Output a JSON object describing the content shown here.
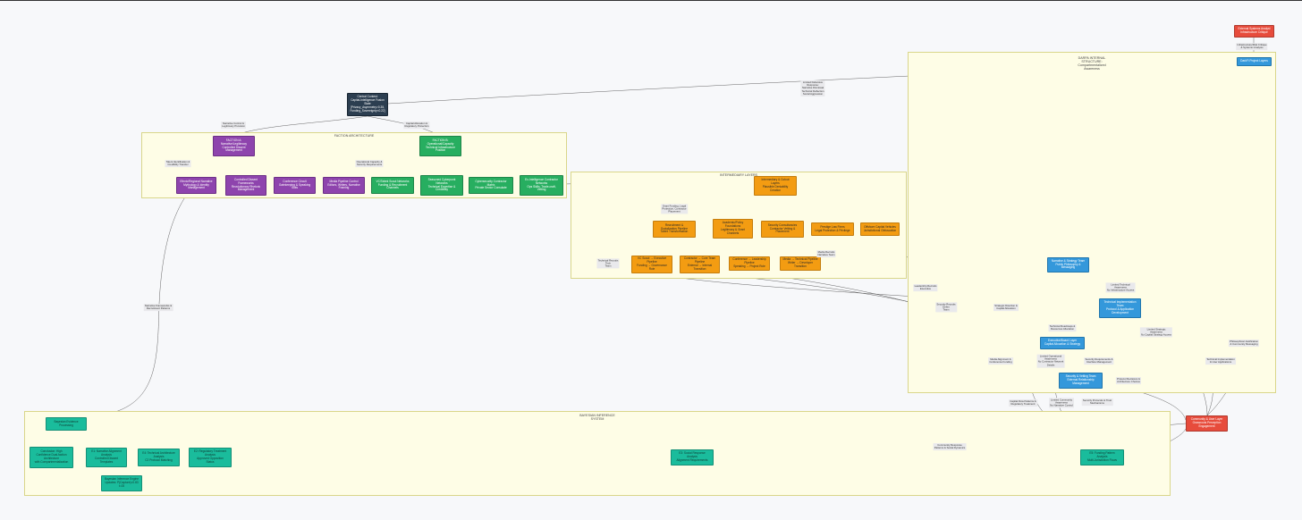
{
  "clusters": {
    "faction": "FACTION ARCHITECTURE",
    "intermediary": "INTERMEDIARY LAYERS",
    "darpa": "DARPA INTERNAL\nSTRUCTURE:\nCompartmentalized\nAwareness",
    "bayesian": "BAYESIAN INFERENCE\nSYSTEM"
  },
  "nodes": {
    "central": "Central Contest:\nCapital-Intelligence Fusion\nState\n[Privacy_Asymmetry>0.35,\nFunding_Sovereignty<0.22]",
    "factionA": "FACTION A:\nNarrative/Legitimacy\nControlled Dissent\nManagement",
    "factionB": "FACTION B:\nOperational/Capacity\nTechnical Infrastructure\nPosition",
    "a1": "Ethnic/Regional Narrative\nMythology & Identity\nManagement",
    "a2": "Controlled Dissent\nFrameworks\nRevolutionary Rhetoric\nManagement",
    "a3": "Conference Circuit\nGatekeeping & Speaking\nSlots",
    "a4": "Media Pipeline Control\nEditors, Writers, Narrative\nFraming",
    "b1": "VC/Talent Scout Networks\nFunding & Recruitment\nChannels",
    "b2": "Seasoned Cyberpunk\nNetworks\nTechnical Expertise &\nCredibility",
    "b3": "Cybersecurity Contractor\nMatrix\nPrivate Sector Consulate",
    "b4": "Ex-Intelligence Contractor\nNetworks\nOps Skills, Trade-craft,\nVetting",
    "intermediaryHub": "Intermediary & Cutout\nLayers\nPlausible Deniability\nCreation",
    "recruitPipeline": "Recruitment &\nSocialization Pipeline\nTalent Transformation",
    "academic": "Academic/Policy\nFoundations\nLegitimacy & Grant\nChannels",
    "securityConsultancies": "Security Consultancies\nContractor Vetting &\nPlacement",
    "lawFirms": "Prestige Law Firms\nLegal Protection & Privilege",
    "offshore": "Offshore Capital Vehicles\nJurisdictional Obfuscation",
    "vcScout": "VC Scout → Executive\nPipeline\nFunding → Governance\nRole",
    "contractorHire": "Contractor → Core Team\nPipeline\nExternal → Internal\nTransition",
    "conferenceLeader": "Conference → Leadership\nPipeline\nSpeaking → Project Role",
    "mediaTech": "Media → Technical Pipeline\nWriter → Developer\nTransition",
    "external": "External Systems Analyst\nInfrastructure Critique",
    "darpaLayer": "DarkFi Project Layers",
    "narrativeTeam": "Narrative & Strategy Team\nPublic Philosophy &\nMessaging",
    "techTeam": "Technical Implementation\nTeam\nProtocol & Application\nDevelopment",
    "execBoard": "Executive/Board Layer\nCapital Allocation & Strategy",
    "securityTeam": "Security & Vetting Team\nExternal Relationship\nManagement",
    "community": "Community & User Layer\nGrassroots Perception\nEngagement",
    "bayesHub": "Bayesian Evidence\nProcessing",
    "conclusion": "Conclusion: High\nConfidence Dual-faction\nArchitecture\nwith Compartmentalization",
    "e1": "E1: Narrative Alignment\nAnalysis\nControlled Dissent\nTemplates",
    "e4": "E4: Technical Architecture\nAnalysis\nC2 Protocol Matching",
    "e2": "E2: Regulatory Treatment\nAnalysis\nApproved Opposition\nStatus",
    "e3": "E3: Social Response\nAnalysis\nAlignment Requirements",
    "e5": "E5: Funding Pattern\nAnalysis\nMulti-Jurisdiction Flows",
    "inferenceEngine": "Bayesian Inference Engine\nUpdates: P(Capture)=0.83\n±.05"
  },
  "edge_labels": {
    "centralToA": "Narrative Control &\nLegitimacy Provision",
    "centralToB": "Capital Allocation &\nRegulatory Protection",
    "centralToDarpa": "Limited Defensive\nResponse:\nNarrative Dismissal\nTechnical Deflection\nSocial Aggression",
    "talent": "Talent Identification &\nCredibility Transfer",
    "opsCapacity": "Operational Capacity &\nSecurity Requirements",
    "grantFunding": "Grant Funding, Legal\nProtection, Contractor\nPlacement",
    "mediaRecruits": "Media Recruits\nNarrative Team",
    "techRecruits": "Technical Recruits\nTech\nTeam",
    "externalLink": "Infrastructure/Risk Critique\n& Systemic Analysis",
    "ltAwareness": "Limited Technical\nAwareness\nNo Infrastructure Access",
    "leaderRecruits": "Leadership Recruits\nExecutive",
    "securityRecruits": "Security Recruits\nDefen\nTeam",
    "stratDirection": "Strategic Direction &\nCapital Allocation",
    "roadmaps": "Technical Roadmaps &\nResources Allocation",
    "ltStrategic": "Limited Strategic\nAwareness\nNo Capital Strategy Access",
    "mediaAlign": "Media Alignment &\nConference Funding",
    "limitedOps": "Limited Operational\nAwareness\nNo Contractor Network\nDetails",
    "secReqs": "Security Requirements &\nInterface Management",
    "philJust": "Philosophical Justification\n& Community Messaging",
    "techImpl": "Technical Implementation\n& User Applications",
    "protocolDecisions": "Protocol Decisions &\nArchitecture Choices",
    "capitalFlow": "Capital Flow Patterns &\nRegulatory Treatment",
    "limitedCommunity": "Limited Community\nAwareness\nNo Narrative Control",
    "securityProtocols": "Security Protocols & Trust\nMechanisms",
    "narrativeFrameworks": "Narrative Frameworks &\nRecruitment Patterns",
    "communityResponse": "Community Response\nPatterns & Social Dynamics"
  }
}
